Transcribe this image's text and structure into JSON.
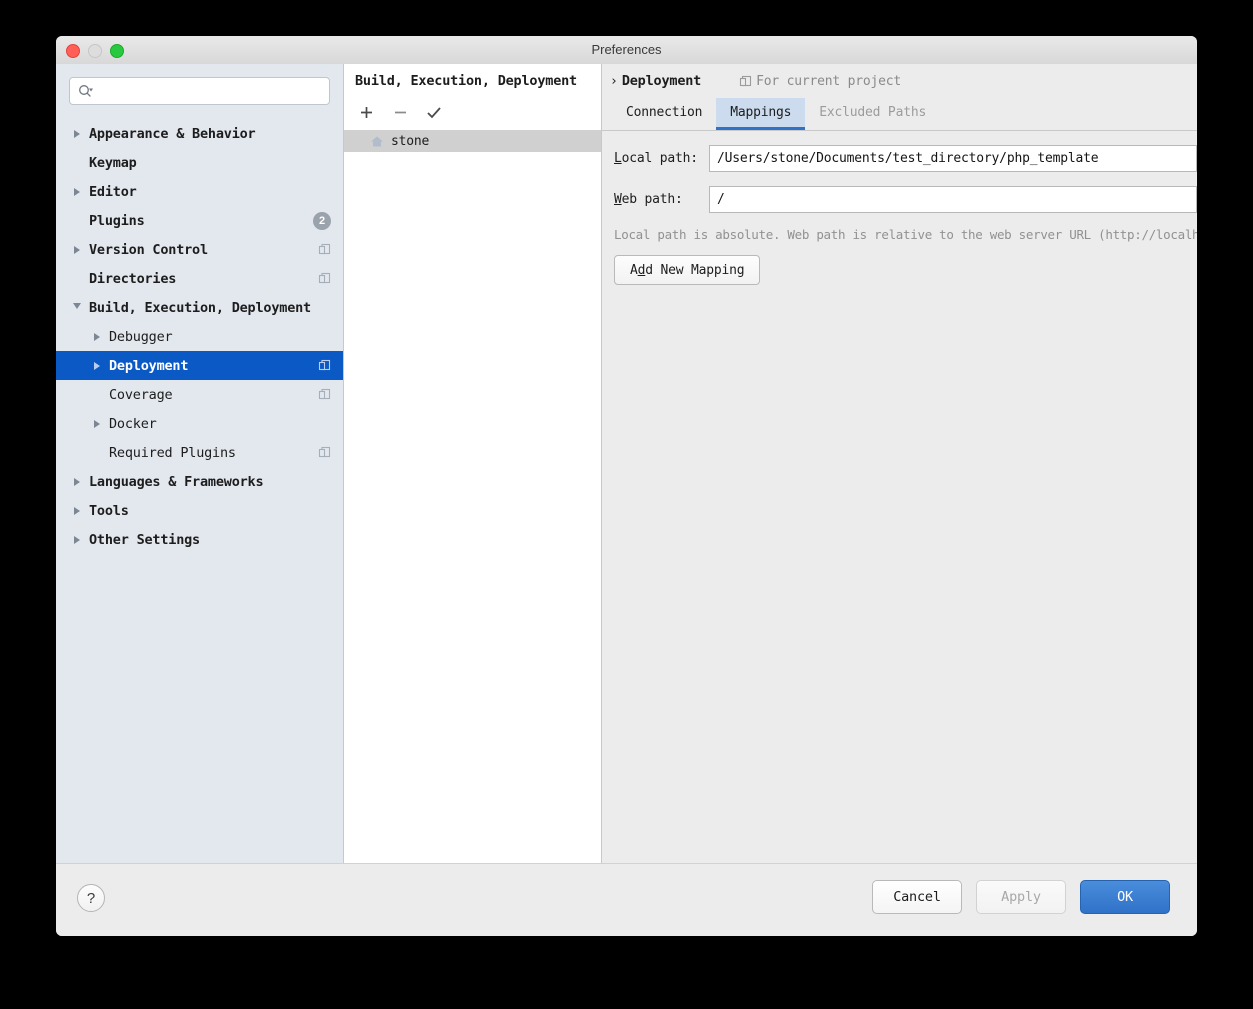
{
  "window": {
    "title": "Preferences",
    "traffic": {
      "close": "close-button",
      "minimize": "minimize-button",
      "maximize": "maximize-button"
    }
  },
  "sidebar": {
    "search": {
      "value": "",
      "placeholder": ""
    },
    "items": [
      {
        "label": "Appearance & Behavior",
        "arrow": "right",
        "indent": 0,
        "bold": true,
        "badge": null,
        "scope": false,
        "selected": false
      },
      {
        "label": "Keymap",
        "arrow": "none",
        "indent": 0,
        "bold": true,
        "badge": null,
        "scope": false,
        "selected": false
      },
      {
        "label": "Editor",
        "arrow": "right",
        "indent": 0,
        "bold": true,
        "badge": null,
        "scope": false,
        "selected": false
      },
      {
        "label": "Plugins",
        "arrow": "none",
        "indent": 0,
        "bold": true,
        "badge": "2",
        "scope": false,
        "selected": false
      },
      {
        "label": "Version Control",
        "arrow": "right",
        "indent": 0,
        "bold": true,
        "badge": null,
        "scope": true,
        "selected": false
      },
      {
        "label": "Directories",
        "arrow": "none",
        "indent": 0,
        "bold": true,
        "badge": null,
        "scope": true,
        "selected": false
      },
      {
        "label": "Build, Execution, Deployment",
        "arrow": "down",
        "indent": 0,
        "bold": true,
        "badge": null,
        "scope": false,
        "selected": false
      },
      {
        "label": "Debugger",
        "arrow": "right",
        "indent": 1,
        "bold": false,
        "badge": null,
        "scope": false,
        "selected": false
      },
      {
        "label": "Deployment",
        "arrow": "right",
        "indent": 1,
        "bold": false,
        "badge": null,
        "scope": true,
        "selected": true
      },
      {
        "label": "Coverage",
        "arrow": "none",
        "indent": 1,
        "bold": false,
        "badge": null,
        "scope": true,
        "selected": false
      },
      {
        "label": "Docker",
        "arrow": "right",
        "indent": 1,
        "bold": false,
        "badge": null,
        "scope": false,
        "selected": false
      },
      {
        "label": "Required Plugins",
        "arrow": "none",
        "indent": 1,
        "bold": false,
        "badge": null,
        "scope": true,
        "selected": false
      },
      {
        "label": "Languages & Frameworks",
        "arrow": "right",
        "indent": 0,
        "bold": true,
        "badge": null,
        "scope": false,
        "selected": false
      },
      {
        "label": "Tools",
        "arrow": "right",
        "indent": 0,
        "bold": true,
        "badge": null,
        "scope": false,
        "selected": false
      },
      {
        "label": "Other Settings",
        "arrow": "right",
        "indent": 0,
        "bold": true,
        "badge": null,
        "scope": false,
        "selected": false
      }
    ]
  },
  "middle": {
    "title": "Build, Execution, Deployment",
    "toolbar": {
      "add": "plus-icon",
      "remove": "minus-icon",
      "set_default": "checkmark-icon"
    },
    "servers": [
      {
        "name": "stone",
        "icon": "home-icon",
        "selected": true
      }
    ]
  },
  "right": {
    "breadcrumb": {
      "separator": "›",
      "current": "Deployment"
    },
    "scope_note": "For current project",
    "tabs": [
      {
        "label": "Connection",
        "state": "normal"
      },
      {
        "label": "Mappings",
        "state": "active"
      },
      {
        "label": "Excluded Paths",
        "state": "disabled"
      }
    ],
    "fields": [
      {
        "label_prefix": "",
        "mnemonic": "L",
        "label_suffix": "ocal path:",
        "value": "/Users/stone/Documents/test_directory/php_template"
      },
      {
        "label_prefix": "",
        "mnemonic": "W",
        "label_suffix": "eb path:",
        "value": "/"
      }
    ],
    "hint": "Local path is absolute. Web path is relative to the web server URL (http://localho",
    "add_mapping": {
      "prefix": "A",
      "mnemonic": "d",
      "suffix": "d New Mapping"
    }
  },
  "footer": {
    "help": "?",
    "cancel": "Cancel",
    "apply": "Apply",
    "ok": "OK"
  },
  "colors": {
    "accent_blue": "#0b59c4",
    "tab_active_bg": "#ccdcee",
    "tab_underline": "#2f72c8",
    "primary_button": "#2f72c8",
    "sidebar_bg": "#e3e8ef",
    "panel_bg": "#ececec"
  }
}
